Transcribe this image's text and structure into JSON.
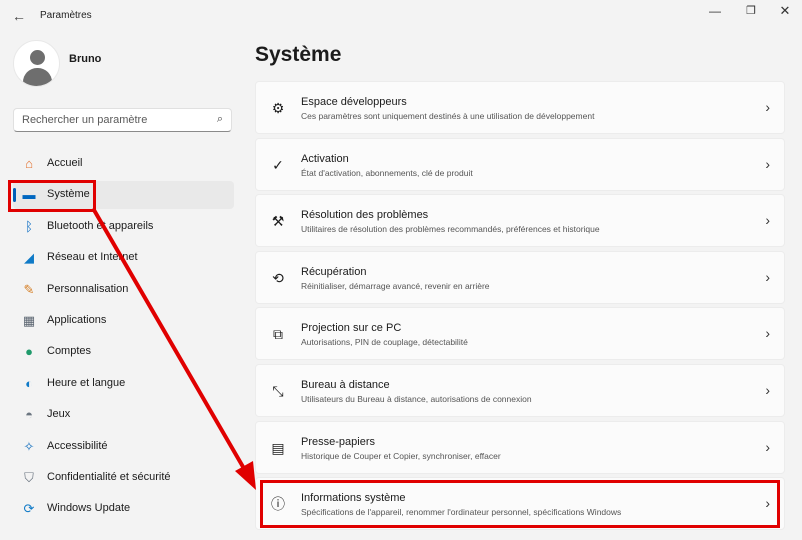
{
  "window": {
    "title": "Paramètres",
    "back_icon": "←",
    "minimize_icon": "—",
    "maximize_icon": "❐",
    "close_icon": "✕"
  },
  "profile": {
    "name": "Bruno"
  },
  "search": {
    "placeholder": "Rechercher un paramètre",
    "icon": "⌕"
  },
  "nav": {
    "items": [
      {
        "label": "Accueil",
        "icon": "home-icon",
        "glyph": "⌂",
        "color": "#e3702e"
      },
      {
        "label": "Système",
        "icon": "system-icon",
        "glyph": "▬",
        "color": "#0067c0",
        "active": true
      },
      {
        "label": "Bluetooth et appareils",
        "icon": "bluetooth-icon",
        "glyph": "ᛒ",
        "color": "#0067c0"
      },
      {
        "label": "Réseau et Internet",
        "icon": "wifi-icon",
        "glyph": "◢",
        "color": "#0f7ac7"
      },
      {
        "label": "Personnalisation",
        "icon": "brush-icon",
        "glyph": "✎",
        "color": "#d47a1d"
      },
      {
        "label": "Applications",
        "icon": "apps-icon",
        "glyph": "▦",
        "color": "#5a6470"
      },
      {
        "label": "Comptes",
        "icon": "account-icon",
        "glyph": "●",
        "color": "#1f9a6b"
      },
      {
        "label": "Heure et langue",
        "icon": "globe-clock-icon",
        "glyph": "◐",
        "color": "#0f7ac7"
      },
      {
        "label": "Jeux",
        "icon": "gamepad-icon",
        "glyph": "◓",
        "color": "#6b7580"
      },
      {
        "label": "Accessibilité",
        "icon": "accessibility-icon",
        "glyph": "✧",
        "color": "#0f6cbd"
      },
      {
        "label": "Confidentialité et sécurité",
        "icon": "shield-icon",
        "glyph": "⛉",
        "color": "#6b7580"
      },
      {
        "label": "Windows Update",
        "icon": "update-icon",
        "glyph": "⟳",
        "color": "#0f7ac7"
      }
    ]
  },
  "main": {
    "title": "Système",
    "cards": [
      {
        "title": "Espace développeurs",
        "subtitle": "Ces paramètres sont uniquement destinés à une utilisation de développement",
        "icon": "developer-tools-icon",
        "glyph": "⚙"
      },
      {
        "title": "Activation",
        "subtitle": "État d'activation, abonnements, clé de produit",
        "icon": "activation-check-icon",
        "glyph": "✓"
      },
      {
        "title": "Résolution des problèmes",
        "subtitle": "Utilitaires de résolution des problèmes recommandés, préférences et historique",
        "icon": "wrench-icon",
        "glyph": "⚒"
      },
      {
        "title": "Récupération",
        "subtitle": "Réinitialiser, démarrage avancé, revenir en arrière",
        "icon": "recovery-icon",
        "glyph": "⟲"
      },
      {
        "title": "Projection sur ce PC",
        "subtitle": "Autorisations, PIN de couplage, détectabilité",
        "icon": "projection-icon",
        "glyph": "⧉"
      },
      {
        "title": "Bureau à distance",
        "subtitle": "Utilisateurs du Bureau à distance, autorisations de connexion",
        "icon": "remote-desktop-icon",
        "glyph": "⤡"
      },
      {
        "title": "Presse-papiers",
        "subtitle": "Historique de Couper et Copier, synchroniser, effacer",
        "icon": "clipboard-icon",
        "glyph": "▤"
      },
      {
        "title": "Informations système",
        "subtitle": "Spécifications de l'appareil, renommer l'ordinateur personnel, spécifications Windows",
        "icon": "info-icon",
        "glyph": "ⓘ"
      }
    ],
    "chevron": "›"
  },
  "annotation": {
    "color": "#e00000"
  }
}
